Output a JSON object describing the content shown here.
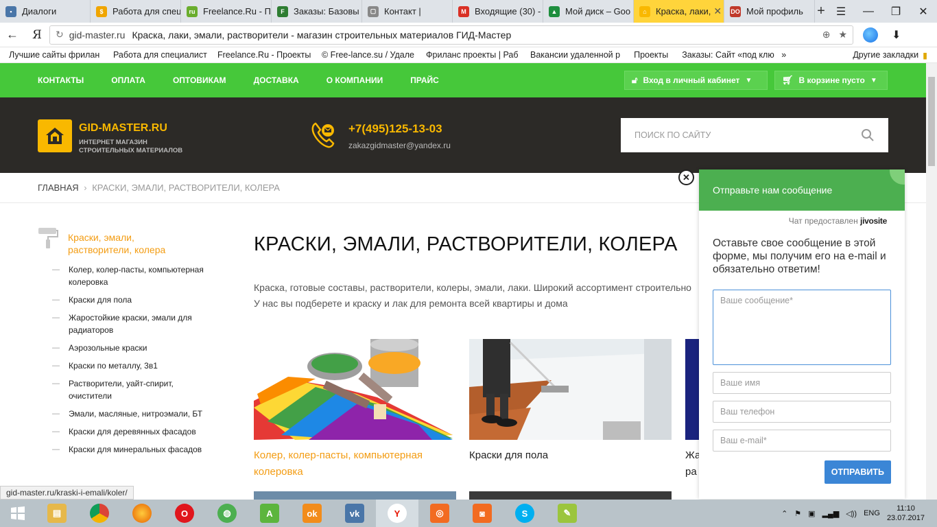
{
  "browser": {
    "tabs": [
      {
        "label": "Диалоги",
        "color": "#4a76a8",
        "glyph": "▪"
      },
      {
        "label": "Работа для спец",
        "color": "#f0a500",
        "glyph": "$"
      },
      {
        "label": "Freelance.Ru - П",
        "color": "#6aad2d",
        "glyph": "ru"
      },
      {
        "label": "Заказы: Базовы",
        "color": "#2e7d32",
        "glyph": "F"
      },
      {
        "label": "Контакт |",
        "color": "#888888",
        "glyph": "▢"
      },
      {
        "label": "Входящие (30) -",
        "color": "#d93025",
        "glyph": "M"
      },
      {
        "label": "Мой диск – Goo",
        "color": "#1e8e3e",
        "glyph": "▲"
      },
      {
        "label": "Краска, лаки,",
        "color": "#f9b800",
        "glyph": "⌂",
        "active": true
      },
      {
        "label": "Мой профиль",
        "color": "#c0392b",
        "glyph": "DO"
      }
    ],
    "new_tab": "+",
    "address": {
      "host": "gid-master.ru",
      "title": "Краска, лаки, эмали, растворители - магазин строительных материалов ГИД-Мастер"
    },
    "yandex_logo": "Я",
    "bookmarks": [
      "Лучшие сайты фрилан",
      "Работа для специалист",
      "Freelance.Ru - Проекты",
      "© Free-lance.su / Удале",
      "Фриланс проекты | Раб",
      "Вакансии удаленной р",
      "Проекты",
      "Заказы: Сайт «под клю"
    ],
    "bookmarks_more": "»",
    "other_bookmarks": "Другие закладки",
    "status_url": "gid-master.ru/kraski-i-emali/koler/"
  },
  "site": {
    "topnav": [
      "КОНТАКТЫ",
      "ОПЛАТА",
      "ОПТОВИКАМ",
      "ДОСТАВКА",
      "О КОМПАНИИ",
      "ПРАЙС"
    ],
    "login_label": "Вход в личный кабинет",
    "cart_label": "В корзине пусто",
    "logo_title": "GID-MASTER.RU",
    "logo_sub1": "ИНТЕРНЕТ МАГАЗИН",
    "logo_sub2": "СТРОИТЕЛЬНЫХ МАТЕРИАЛОВ",
    "phone": "+7(495)125-13-03",
    "email": "zakazgidmaster@yandex.ru",
    "search_placeholder": "ПОИСК ПО САЙТУ",
    "breadcrumbs": {
      "home": "ГЛАВНАЯ",
      "sep": "›",
      "current": "КРАСКИ, ЭМАЛИ, РАСТВОРИТЕЛИ, КОЛЕРА"
    },
    "sidebar": {
      "heading": "Краски, эмали, растворители, колера",
      "items": [
        "Колер, колер-пасты, компьютерная колеровка",
        "Краски для пола",
        "Жаростойкие краски, эмали для радиаторов",
        "Аэрозольные краски",
        "Краски по металлу, 3в1",
        "Растворители, уайт-спирит, очистители",
        "Эмали, масляные, нитроэмали, БТ",
        "Краски для деревянных фасадов",
        "Краски для минеральных фасадов"
      ]
    },
    "page_title": "КРАСКИ, ЭМАЛИ, РАСТВОРИТЕЛИ, КОЛЕРА",
    "intro_line1": "Краска, готовые составы, растворители, колеры, эмали, лаки. Широкий ассортимент строительно",
    "intro_line2": "У нас вы подберете и краску и лак для ремонта всей квартиры и дома",
    "cards": [
      {
        "caption": "Колер, колер-пасты, компьютерная колеровка",
        "color": "#f39c12"
      },
      {
        "caption": "Краски для пола",
        "color": "#222222"
      },
      {
        "caption": "Жа ра",
        "color": "#222222"
      }
    ]
  },
  "chat": {
    "header": "Отправьте нам сообщение",
    "provided_by": "Чат предоставлен",
    "brand": "jivosite",
    "intro": "Оставьте свое сообщение в этой форме, мы получим его на e-mail и обязательно ответим!",
    "message_placeholder": "Ваше сообщение*",
    "name_placeholder": "Ваше имя",
    "phone_placeholder": "Ваш телефон",
    "email_placeholder": "Ваш e-mail*",
    "send_label": "ОТПРАВИТЬ"
  },
  "taskbar": {
    "lang": "ENG",
    "time": "11:10",
    "date": "23.07.2017"
  },
  "colors": {
    "green": "#46c83a",
    "dark": "#2c2a27",
    "accent": "#f9b800",
    "link_orange": "#f39c12",
    "chat_green": "#4caf50",
    "send_blue": "#3b86d6"
  }
}
